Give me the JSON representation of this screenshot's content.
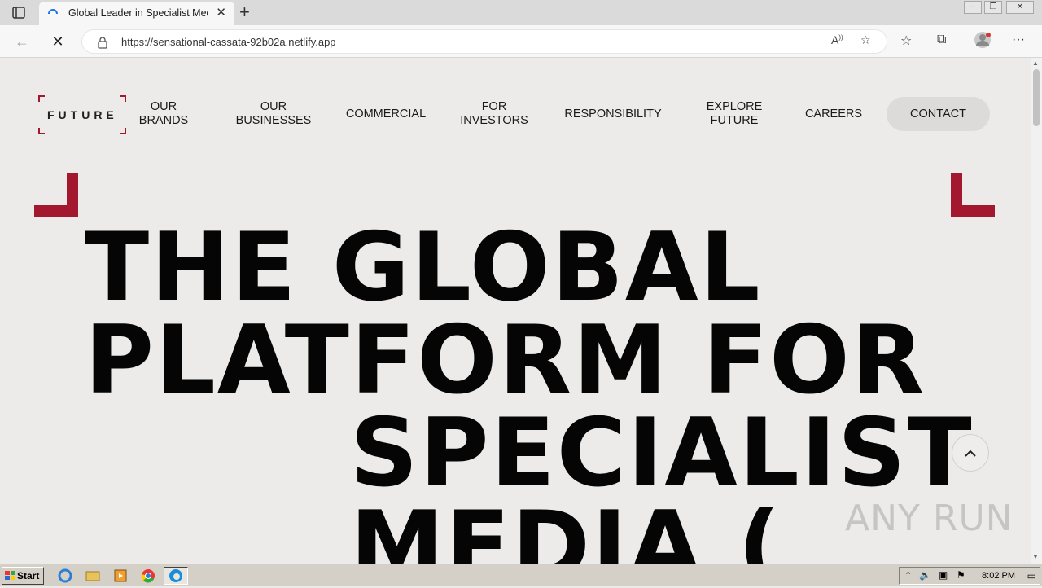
{
  "browser": {
    "tab_title": "Global Leader in Specialist Media",
    "url": "https://sensational-cassata-92b02a.netlify.app"
  },
  "site": {
    "logo_text": "FUTURE",
    "nav": [
      {
        "line1": "OUR",
        "line2": "BRANDS"
      },
      {
        "line1": "OUR",
        "line2": "BUSINESSES"
      },
      {
        "line1": "COMMERCIAL",
        "line2": ""
      },
      {
        "line1": "FOR",
        "line2": "INVESTORS"
      },
      {
        "line1": "RESPONSIBILITY",
        "line2": ""
      },
      {
        "line1": "EXPLORE",
        "line2": "FUTURE"
      },
      {
        "line1": "CAREERS",
        "line2": ""
      }
    ],
    "contact_label": "CONTACT",
    "hero": [
      "THE GLOBAL",
      "PLATFORM FOR",
      "SPECIALIST",
      "MEDIA ("
    ]
  },
  "watermark": "ANY RUN",
  "taskbar": {
    "start_label": "Start",
    "clock": "8:02 PM"
  },
  "colors": {
    "accent": "#a3182f",
    "page_bg": "#ecebea"
  }
}
